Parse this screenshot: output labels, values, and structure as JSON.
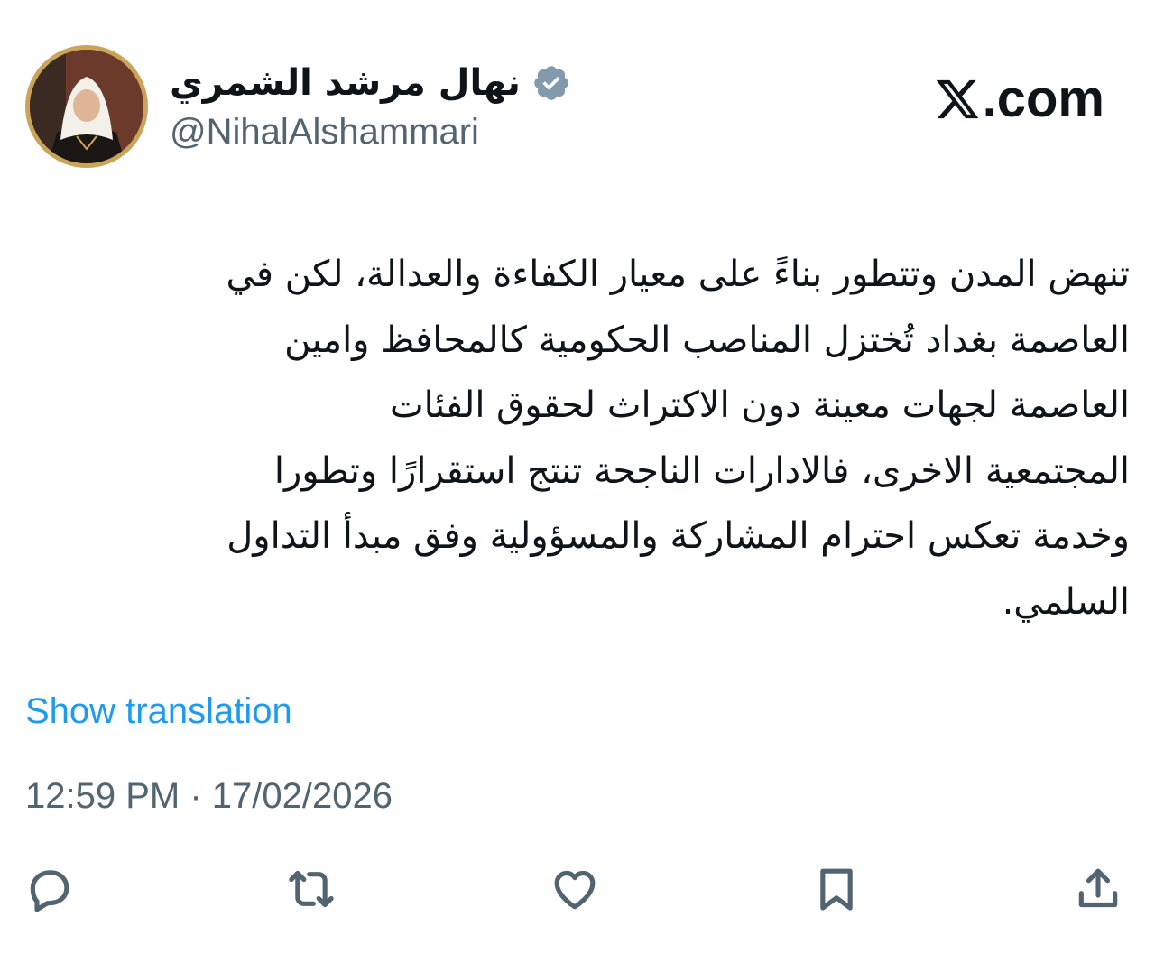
{
  "author": {
    "display_name": "نهال مرشد الشمري",
    "handle": "@NihalAlshammari",
    "verified": true
  },
  "brand": {
    "text": ".com",
    "icon": "x-logo-icon"
  },
  "tweet": {
    "lines": [
      "تنهض المدن وتتطور بناءً على معيار الكفاءة والعدالة، لكن في",
      "العاصمة بغداد تُختزل المناصب الحكومية كالمحافظ وامين",
      "العاصمة لجهات معينة دون الاكتراث لحقوق الفئات",
      "المجتمعية الاخرى، فالادارات الناجحة تنتج استقرارًا وتطورا",
      "وخدمة تعكس احترام المشاركة والمسؤولية وفق مبدأ التداول",
      "السلمي."
    ],
    "show_translation": "Show translation",
    "timestamp": "12:59 PM · 17/02/2026"
  },
  "actions": [
    {
      "name": "reply-icon"
    },
    {
      "name": "retweet-icon"
    },
    {
      "name": "like-icon"
    },
    {
      "name": "bookmark-icon"
    },
    {
      "name": "share-icon"
    }
  ],
  "colors": {
    "text": "#0f1419",
    "secondary": "#536471",
    "link": "#1d9bf0",
    "verified_badge": "#829aab",
    "avatar_ring": "#c9a45a"
  }
}
